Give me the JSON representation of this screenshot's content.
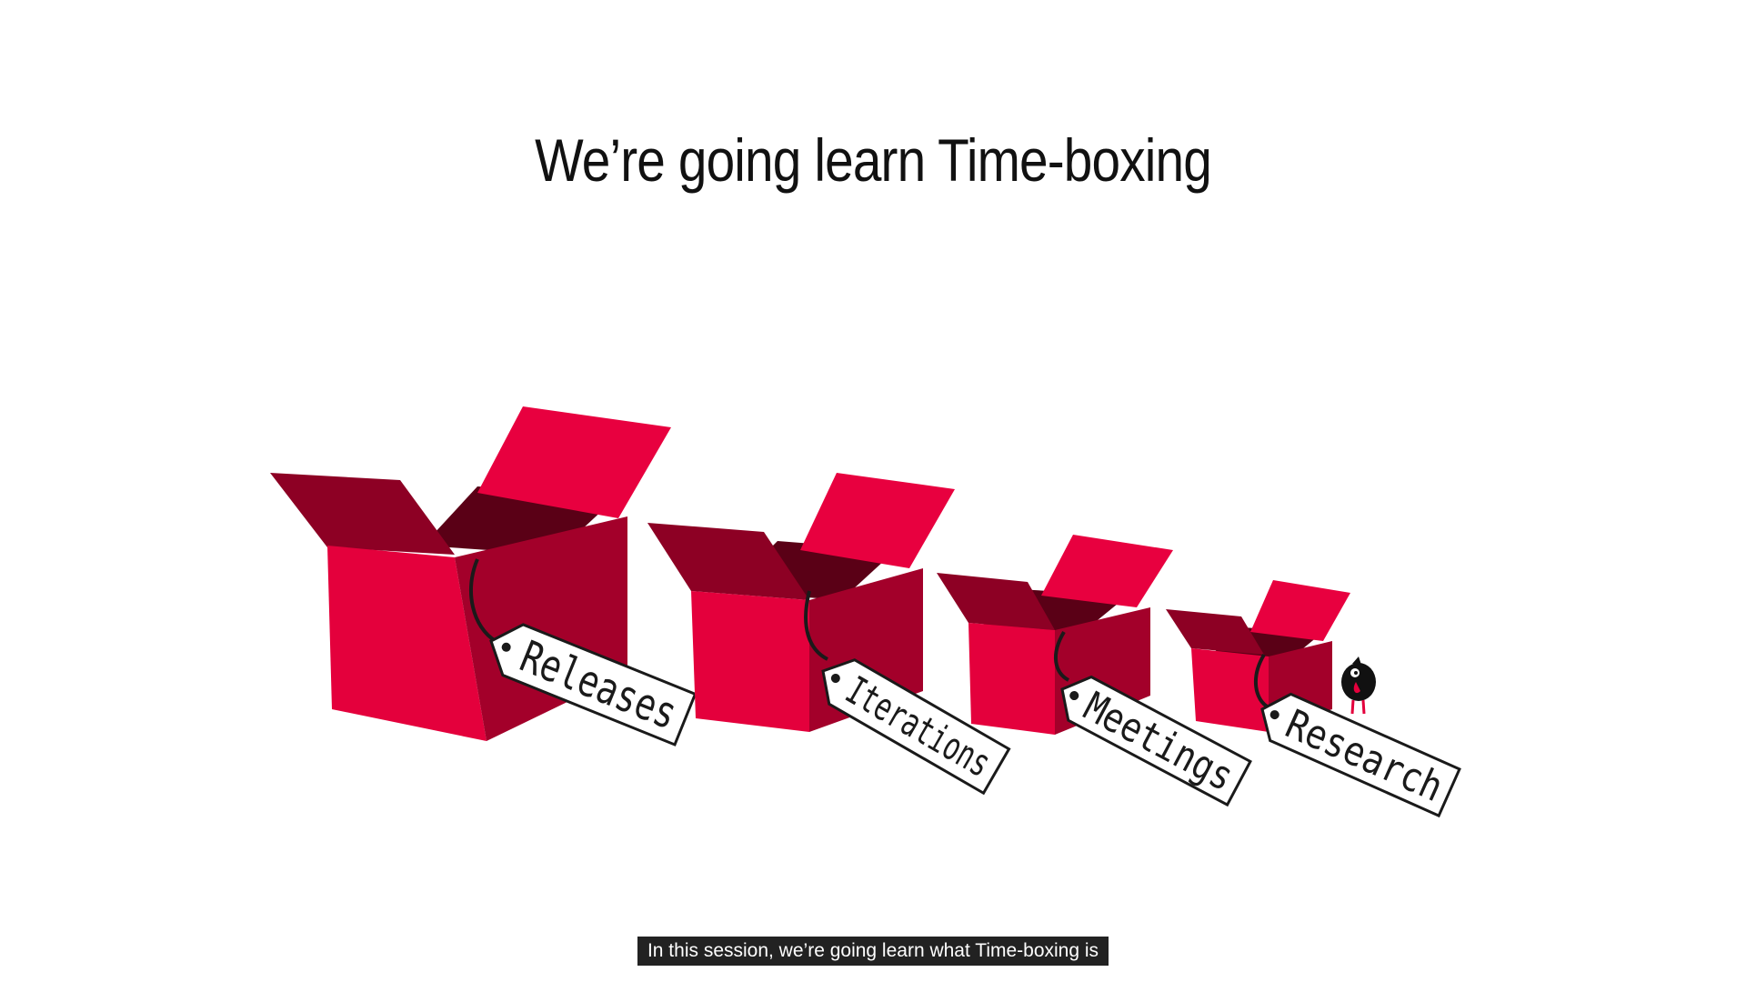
{
  "slide": {
    "title": "We’re going learn Time-boxing"
  },
  "boxes": [
    {
      "label": "Releases"
    },
    {
      "label": "Iterations"
    },
    {
      "label": "Meetings"
    },
    {
      "label": "Research"
    }
  ],
  "caption": {
    "text": "In this session, we’re going learn what Time-boxing is"
  },
  "colors": {
    "box_front": "#e4003c",
    "box_side": "#a3002a",
    "box_inside": "#5a0016",
    "flap": "#e8003f",
    "tag_fill": "#ffffff",
    "tag_stroke": "#1a1a1a",
    "caption_bg": "#222222"
  },
  "icons": [
    "bird-icon"
  ]
}
